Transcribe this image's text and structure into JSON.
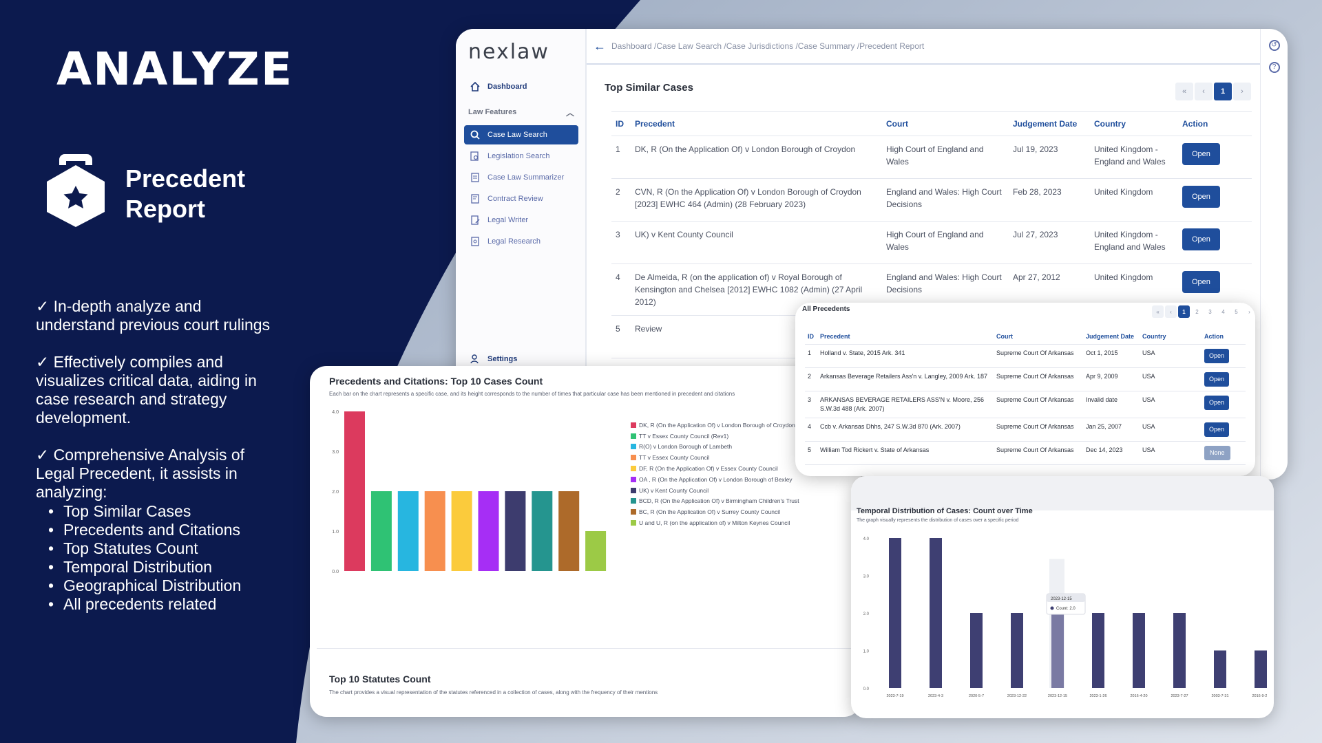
{
  "hero": {
    "title": "ANALYZE",
    "feature": "Precedent Report",
    "points": [
      "✓ In-depth analyze and understand previous court rulings",
      "✓ Effectively compiles and visualizes critical data, aiding in case research and strategy development.",
      "✓  Comprehensive Analysis of Legal Precedent, it assists in analyzing:"
    ],
    "list": [
      "Top Similar Cases",
      "Precedents and Citations",
      "Top Statutes Count",
      "Temporal Distribution",
      "Geographical Distribution",
      "All precedents related"
    ]
  },
  "app": {
    "logo": "nexlaw",
    "breadcrumb": "Dashboard /Case Law Search /Case Jurisdictions /Case Summary /Precedent Report",
    "nav": {
      "dashboard": "Dashboard",
      "section": "Law Features",
      "items": [
        "Case Law Search",
        "Legislation Search",
        "Case Law Summarizer",
        "Contract Review",
        "Legal Writer",
        "Legal Research"
      ],
      "settings": "Settings"
    }
  },
  "similar": {
    "title": "Top Similar Cases",
    "pager": [
      "«",
      "‹",
      "1",
      "›"
    ],
    "headers": [
      "ID",
      "Precedent",
      "Court",
      "Judgement Date",
      "Country",
      "Action"
    ],
    "rows": [
      {
        "id": "1",
        "precedent": "DK, R (On the Application Of) v London Borough of Croydon",
        "court": "High Court of England and Wales",
        "date": "Jul 19, 2023",
        "country": "United Kingdom - England and Wales",
        "action": "Open"
      },
      {
        "id": "2",
        "precedent": "CVN, R (On the Application Of) v London Borough of Croydon [2023] EWHC 464 (Admin) (28 February 2023)",
        "court": "England and Wales: High Court Decisions",
        "date": "Feb 28, 2023",
        "country": "United Kingdom",
        "action": "Open"
      },
      {
        "id": "3",
        "precedent": "UK) v Kent County Council",
        "court": "High Court of England and Wales",
        "date": "Jul 27, 2023",
        "country": "United Kingdom - England and Wales",
        "action": "Open"
      },
      {
        "id": "4",
        "precedent": "De Almeida, R (on the application of) v Royal Borough of Kensington and Chelsea [2012] EWHC 1082 (Admin) (27 April 2012)",
        "court": "England and Wales: High Court Decisions",
        "date": "Apr 27, 2012",
        "country": "United Kingdom",
        "action": "Open"
      },
      {
        "id": "5",
        "precedent": "Review",
        "court": "",
        "date": "",
        "country": "",
        "action": ""
      }
    ]
  },
  "all_precedents": {
    "title": "All Precedents",
    "pager": [
      "«",
      "‹",
      "1",
      "2",
      "3",
      "4",
      "5",
      "›"
    ],
    "headers": [
      "ID",
      "Precedent",
      "Court",
      "Judgement Date",
      "Country",
      "Action"
    ],
    "rows": [
      {
        "id": "1",
        "precedent": "Holland v. State, 2015 Ark. 341",
        "court": "Supreme Court Of Arkansas",
        "date": "Oct 1, 2015",
        "country": "USA",
        "action": "Open"
      },
      {
        "id": "2",
        "precedent": "Arkansas Beverage Retailers Ass'n v. Langley, 2009 Ark. 187",
        "court": "Supreme Court Of Arkansas",
        "date": "Apr 9, 2009",
        "country": "USA",
        "action": "Open"
      },
      {
        "id": "3",
        "precedent": "ARKANSAS BEVERAGE RETAILERS ASS'N v. Moore, 256 S.W.3d 488 (Ark. 2007)",
        "court": "Supreme Court Of Arkansas",
        "date": "Invalid date",
        "country": "USA",
        "action": "Open"
      },
      {
        "id": "4",
        "precedent": "Ccb v. Arkansas Dhhs, 247 S.W.3d 870 (Ark. 2007)",
        "court": "Supreme Court Of Arkansas",
        "date": "Jan 25, 2007",
        "country": "USA",
        "action": "Open"
      },
      {
        "id": "5",
        "precedent": "William Tod Rickert v. State of Arkansas",
        "court": "Supreme Court Of Arkansas",
        "date": "Dec 14, 2023",
        "country": "USA",
        "action": "None"
      }
    ]
  },
  "precedents_chart": {
    "title": "Precedents and Citations: Top 10 Cases Count",
    "subtitle": "Each bar on the chart represents a specific case, and its height corresponds to the number of times that particular case has been mentioned in precedent and citations",
    "statutes_title": "Top 10 Statutes Count",
    "statutes_subtitle": "The chart provides a visual representation of the statutes referenced in a collection of cases, along with the frequency of their mentions"
  },
  "temporal_chart": {
    "title": "Temporal Distribution of Cases: Count over Time",
    "subtitle": "The graph visually represents the distribution of cases over a specific period",
    "tooltip_date": "2023-12-15",
    "tooltip_label": "Count",
    "tooltip_value": "2.0"
  },
  "chart_data": [
    {
      "type": "bar",
      "title": "Precedents and Citations: Top 10 Cases Count",
      "categories": [
        "DK, R (On the Application Of) v London Borough of Croydon",
        "TT v Essex County Council (Rev1)",
        "R(O) v London Borough of Lambeth",
        "TT v Essex County Council",
        "DF, R (On the Application Of) v Essex County Council",
        "OA , R (On the Application Of) v London Borough of Bexley",
        "UK) v Kent County Council",
        "BCD, R (On the Application Of) v Birmingham Children's Trust",
        "BC, R (On the Application Of) v Surrey County Council",
        "U and U, R (on the application of) v Milton Keynes Council"
      ],
      "values": [
        4,
        2,
        2,
        2,
        2,
        2,
        2,
        2,
        2,
        1
      ],
      "colors": [
        "#dc3a5e",
        "#2fc274",
        "#27b6e0",
        "#f78f4f",
        "#fbcb3c",
        "#a62ef5",
        "#3d3c6e",
        "#25958f",
        "#ad6a2a",
        "#9cca46"
      ],
      "yticks": [
        "0.0",
        "1.0",
        "2.0",
        "3.0",
        "4.0"
      ],
      "ylim": [
        0,
        4
      ],
      "legend": "right"
    },
    {
      "type": "bar",
      "title": "Temporal Distribution of Cases: Count over Time",
      "categories": [
        "2023-7-19",
        "2023-4-3",
        "2020-5-7",
        "2023-12-22",
        "2023-12-15",
        "2023-1-26",
        "2016-4-20",
        "2023-7-27",
        "2003-7-31",
        "2016-9-28"
      ],
      "values": [
        4,
        4,
        2,
        2,
        2,
        2,
        2,
        2,
        1,
        1
      ],
      "series": [
        {
          "name": "Count",
          "values": [
            4,
            4,
            2,
            2,
            2,
            2,
            2,
            2,
            1,
            1
          ]
        }
      ],
      "yticks": [
        "0.0",
        "1.0",
        "2.0",
        "3.0",
        "4.0"
      ],
      "ylim": [
        0,
        4
      ],
      "highlight_index": 4,
      "bar_color": "#3e3f72",
      "highlight_color": "#7a7aa3"
    }
  ]
}
